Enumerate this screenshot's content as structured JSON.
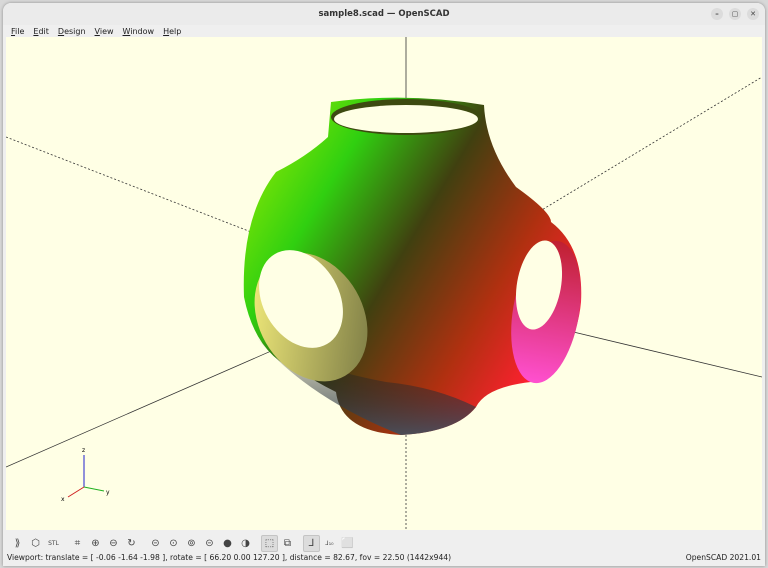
{
  "window": {
    "title": "sample8.scad — OpenSCAD",
    "controls": [
      "–",
      "▢",
      "✕"
    ]
  },
  "menu": [
    "File",
    "Edit",
    "Design",
    "View",
    "Window",
    "Help"
  ],
  "toolbar": [
    {
      "icon": "preview-icon",
      "glyph": "⟫"
    },
    {
      "icon": "render-icon",
      "glyph": "⬡"
    },
    {
      "icon": "export-stl-icon",
      "glyph": "STL"
    },
    {
      "icon": "view-all-icon",
      "glyph": "⌗"
    },
    {
      "icon": "zoom-in-icon",
      "glyph": "⊕"
    },
    {
      "icon": "zoom-out-icon",
      "glyph": "⊖"
    },
    {
      "icon": "reset-view-icon",
      "glyph": "↻"
    },
    {
      "icon": "view-right-icon",
      "glyph": "⊝"
    },
    {
      "icon": "view-top-icon",
      "glyph": "⊙"
    },
    {
      "icon": "view-bottom-icon",
      "glyph": "⊚"
    },
    {
      "icon": "view-left-icon",
      "glyph": "⊝"
    },
    {
      "icon": "view-front-icon",
      "glyph": "●"
    },
    {
      "icon": "view-back-icon",
      "glyph": "◑"
    },
    {
      "icon": "perspective-icon",
      "glyph": "⬚",
      "active": true
    },
    {
      "icon": "orthogonal-icon",
      "glyph": "⧉"
    },
    {
      "icon": "show-axes-icon",
      "glyph": "⅃",
      "active": true
    },
    {
      "icon": "show-scale-icon",
      "glyph": "⅃₁₀"
    },
    {
      "icon": "show-edges-icon",
      "glyph": "⬜"
    }
  ],
  "status": {
    "viewport": "Viewport: translate = [ -0.06 -1.64 -1.98 ], rotate = [ 66.20 0.00 127.20 ], distance = 82.67, fov = 22.50 (1442x944)",
    "version": "OpenSCAD 2021.01"
  },
  "axes_labels": {
    "x": "x",
    "y": "y",
    "z": "z"
  },
  "colors": {
    "viewport_bg": "#ffffe5",
    "x_axis": "#d02020",
    "y_axis": "#20b020",
    "z_axis": "#2020d0"
  }
}
